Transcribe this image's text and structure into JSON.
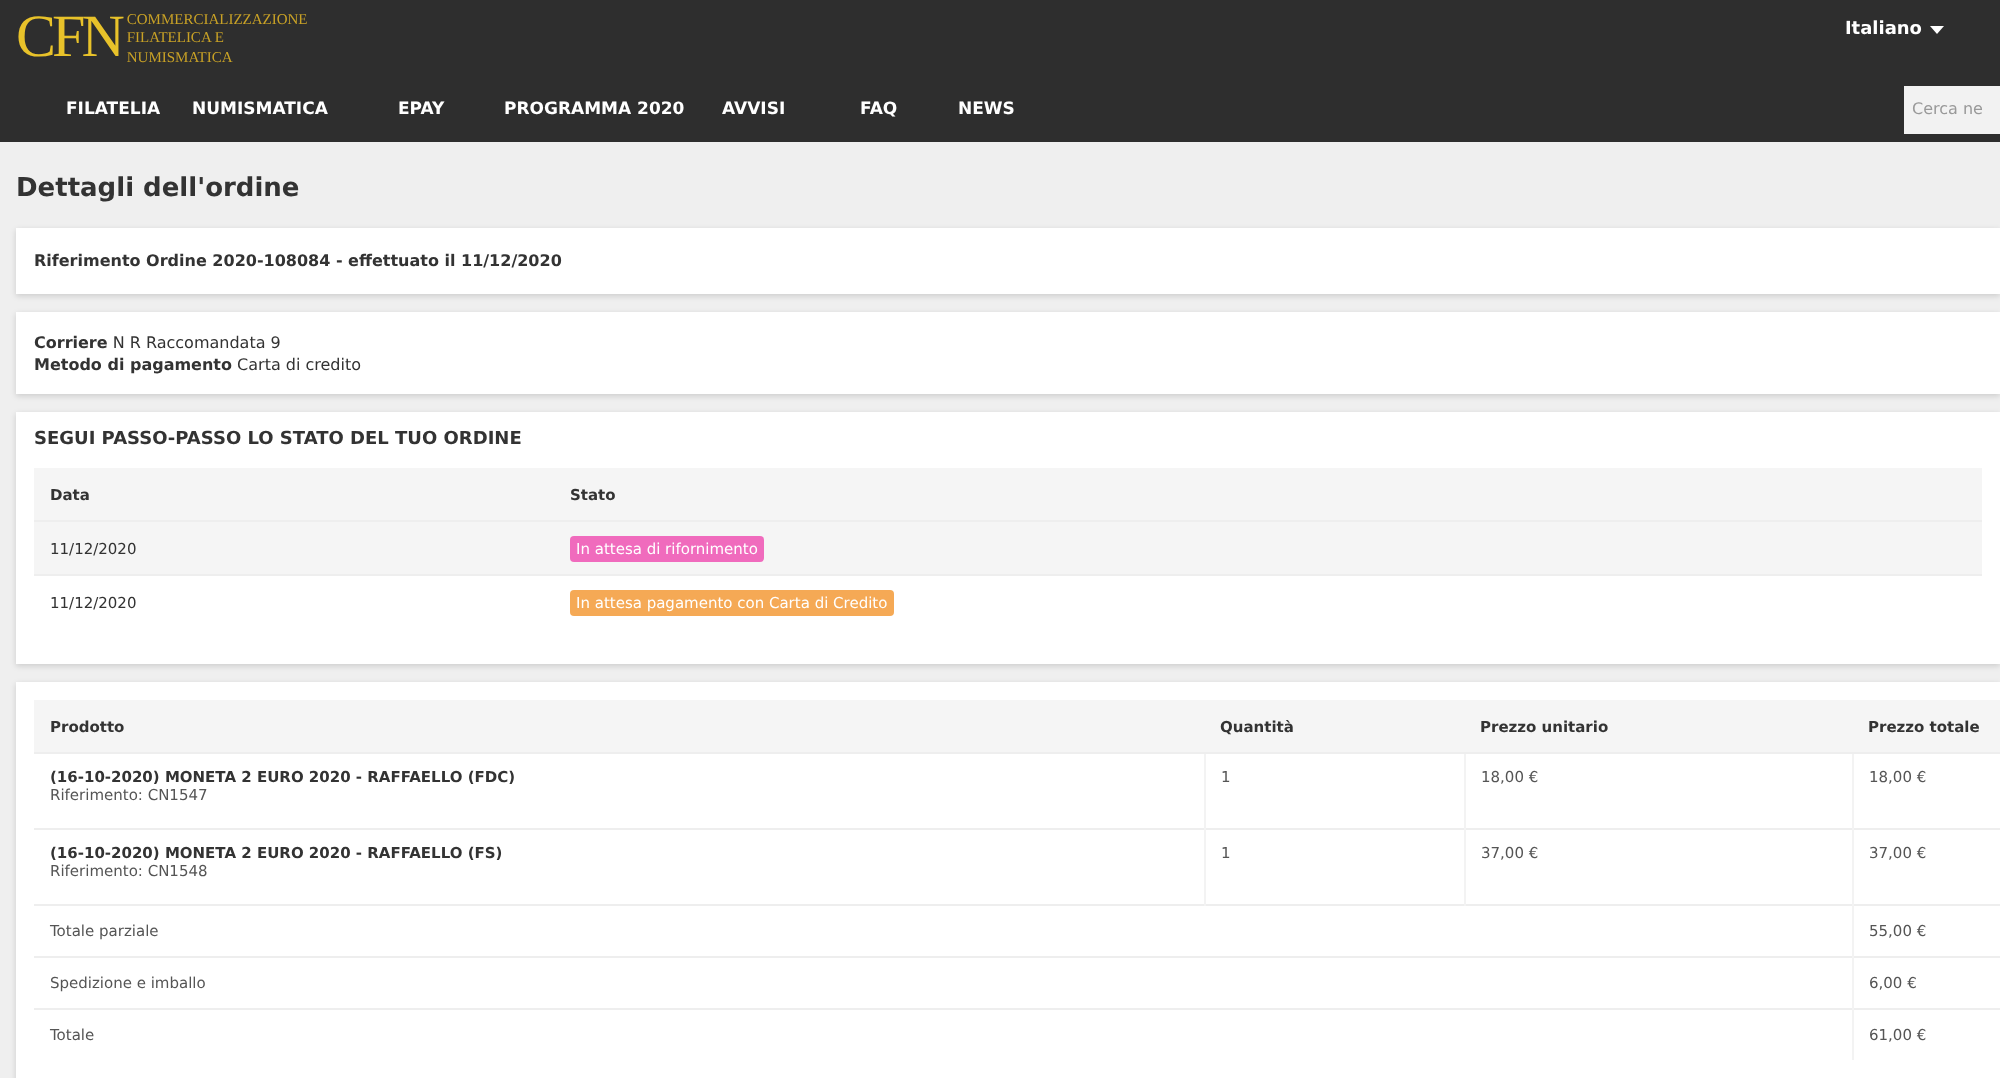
{
  "header": {
    "logo": {
      "mark": "CFN",
      "lines": [
        "COMMERCIALIZZAZIONE",
        "FILATELICA E",
        "NUMISMATICA"
      ]
    },
    "language": "Italiano",
    "nav": [
      "FILATELIA",
      "NUMISMATICA",
      "EPAY",
      "PROGRAMMA 2020",
      "AVVISI",
      "FAQ",
      "NEWS"
    ],
    "search": {
      "placeholder": "Cerca ne"
    }
  },
  "page_title": "Dettagli dell'ordine",
  "order_reference": "Riferimento Ordine 2020-108084 - effettuato il 11/12/2020",
  "details": [
    {
      "label": "Corriere",
      "value": "N R Raccomandata 9"
    },
    {
      "label": "Metodo di pagamento",
      "value": "Carta di credito"
    }
  ],
  "tracking": {
    "title": "SEGUI PASSO-PASSO LO STATO DEL TUO ORDINE",
    "columns": [
      "Data",
      "Stato"
    ],
    "rows": [
      {
        "date": "11/12/2020",
        "status": "In attesa di rifornimento",
        "color": "#f06bbd"
      },
      {
        "date": "11/12/2020",
        "status": "In attesa pagamento con Carta di Credito",
        "color": "#f5a955"
      }
    ]
  },
  "products": {
    "columns": [
      "Prodotto",
      "Quantità",
      "Prezzo unitario",
      "Prezzo totale"
    ],
    "items": [
      {
        "name": "(16-10-2020) MONETA 2 EURO 2020 - RAFFAELLO (FDC)",
        "reference": "Riferimento: CN1547",
        "quantity": "1",
        "unit_price": "18,00 €",
        "total_price": "18,00 €"
      },
      {
        "name": "(16-10-2020) MONETA 2 EURO 2020 - RAFFAELLO (FS)",
        "reference": "Riferimento: CN1548",
        "quantity": "1",
        "unit_price": "37,00 €",
        "total_price": "37,00 €"
      }
    ],
    "totals": [
      {
        "label": "Totale parziale",
        "value": "55,00 €"
      },
      {
        "label": "Spedizione e imballo",
        "value": "6,00 €"
      },
      {
        "label": "Totale",
        "value": "61,00 €"
      }
    ]
  }
}
